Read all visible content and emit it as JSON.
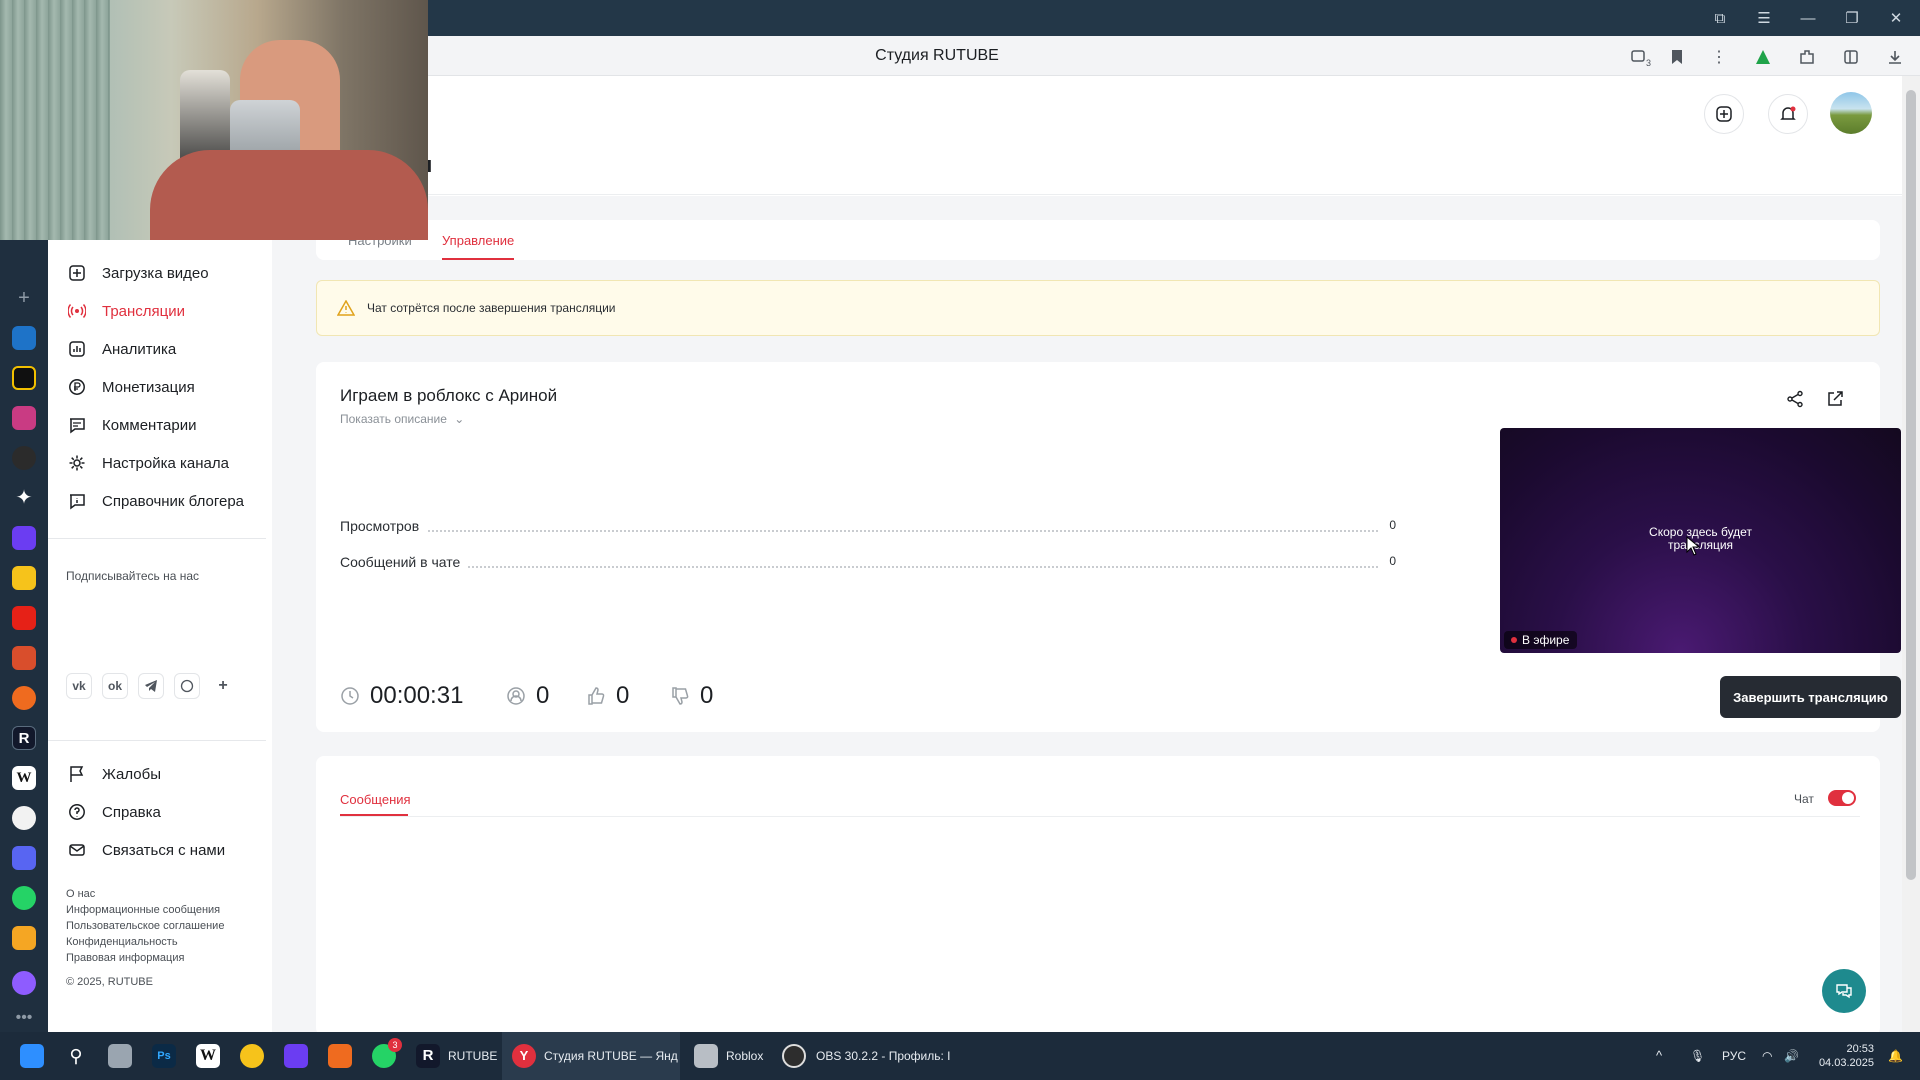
{
  "browser": {
    "title": "Студия RUTUBE",
    "tab_count_badge": "3"
  },
  "page": {
    "heading_fragment": "ия",
    "tabs": [
      "Настройки",
      "Управление"
    ],
    "active_tab": "Управление"
  },
  "sidebar": {
    "nav": [
      {
        "label": "Загрузка видео",
        "icon": "upload-icon"
      },
      {
        "label": "Трансляции",
        "icon": "broadcast-icon",
        "active": true
      },
      {
        "label": "Аналитика",
        "icon": "analytics-icon"
      },
      {
        "label": "Монетизация",
        "icon": "ruble-icon"
      },
      {
        "label": "Комментарии",
        "icon": "comment-icon"
      },
      {
        "label": "Настройка канала",
        "icon": "gear-icon"
      },
      {
        "label": "Справочник блогера",
        "icon": "info-bubble-icon"
      }
    ],
    "subscribe_title": "Подписывайтесь на нас",
    "social": [
      "vk",
      "ok",
      "telegram",
      "viber",
      "more"
    ],
    "support": [
      {
        "label": "Жалобы",
        "icon": "flag-icon"
      },
      {
        "label": "Справка",
        "icon": "help-icon"
      },
      {
        "label": "Связаться с нами",
        "icon": "mail-icon"
      }
    ],
    "footer_links": [
      "О нас",
      "Информационные сообщения",
      "Пользовательское соглашение",
      "Конфиденциальность",
      "Правовая информация"
    ],
    "copyright": "© 2025, RUTUBE"
  },
  "notice": {
    "text": "Чат сотрётся после завершения трансляции"
  },
  "stream": {
    "title": "Играем в роблокс с Ариной",
    "show_description": "Показать описание",
    "stats": [
      {
        "label": "Просмотров",
        "value": "0"
      },
      {
        "label": "Сообщений в чате",
        "value": "0"
      }
    ],
    "duration": "00:00:31",
    "viewers": "0",
    "likes": "0",
    "dislikes": "0",
    "preview_text": "Скоро здесь будет трансляция",
    "live_badge": "В эфире",
    "end_button": "Завершить трансляцию"
  },
  "chat": {
    "tab": "Сообщения",
    "toggle_label": "Чат",
    "toggle_on": true
  },
  "taskbar": {
    "apps": [
      {
        "label": "RUTUBE"
      },
      {
        "label": "Студия RUTUBE — Янд"
      },
      {
        "label": "Roblox"
      },
      {
        "label": "OBS 30.2.2 - Профиль: I"
      }
    ],
    "whatsapp_badge": "3",
    "language": "РУС",
    "time": "20:53",
    "date": "04.03.2025"
  },
  "colors": {
    "accent": "#e0303e",
    "dark": "#262b33",
    "titlebar": "#233748"
  }
}
